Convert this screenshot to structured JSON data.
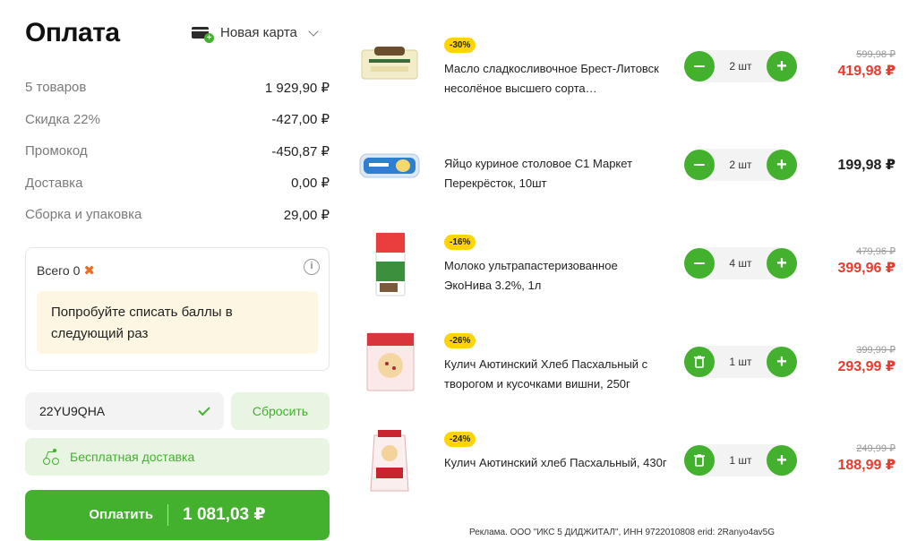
{
  "header": {
    "title": "Оплата",
    "card_label": "Новая карта"
  },
  "summary": [
    {
      "label": "5 товаров",
      "value": "1 929,90 ₽"
    },
    {
      "label": "Скидка 22%",
      "value": "-427,00 ₽"
    },
    {
      "label": "Промокод",
      "value": "-450,87 ₽"
    },
    {
      "label": "Доставка",
      "value": "0,00 ₽"
    },
    {
      "label": "Сборка и упаковка",
      "value": "29,00 ₽"
    }
  ],
  "bonus": {
    "total_label": "Всего 0",
    "hint": "Попробуйте списать баллы в следующий раз"
  },
  "promo": {
    "code": "22YU9QHA",
    "reset_label": "Сбросить"
  },
  "free_delivery_label": "Бесплатная доставка",
  "pay": {
    "label": "Оплатить",
    "amount": "1 081,03 ₽"
  },
  "items": [
    {
      "discount": "-30%",
      "name": "Масло сладкосливочное Брест-Литовск несолёное высшего сорта…",
      "qty": "2 шт",
      "old_price": "599,98 ₽",
      "price": "419,98 ₽",
      "left_button": "minus-icon"
    },
    {
      "discount": "",
      "name": "Яйцо куриное столовое С1 Маркет Перекрёсток, 10шт",
      "qty": "2 шт",
      "old_price": "",
      "price": "199,98 ₽",
      "left_button": "minus-icon"
    },
    {
      "discount": "-16%",
      "name": "Молоко ультрапастеризованное ЭкоНива 3.2%, 1л",
      "qty": "4 шт",
      "old_price": "479,96 ₽",
      "price": "399,96 ₽",
      "left_button": "minus-icon"
    },
    {
      "discount": "-26%",
      "name": "Кулич Аютинский Хлеб Пасхальный с творогом и кусочками вишни, 250г",
      "qty": "1 шт",
      "old_price": "399,99 ₽",
      "price": "293,99 ₽",
      "left_button": "trash-icon"
    },
    {
      "discount": "-24%",
      "name": "Кулич Аютинский хлеб Пасхальный, 430г",
      "qty": "1 шт",
      "old_price": "249,99 ₽",
      "price": "188,99 ₽",
      "left_button": "trash-icon"
    }
  ],
  "ad_text": "Реклама. ООО \"ИКС 5 ДИДЖИТАЛ\", ИНН 9722010808 erid: 2Ranyo4av5G",
  "colors": {
    "accent": "#43b12e",
    "sale": "#e63b2e",
    "badge": "#ffd400"
  }
}
